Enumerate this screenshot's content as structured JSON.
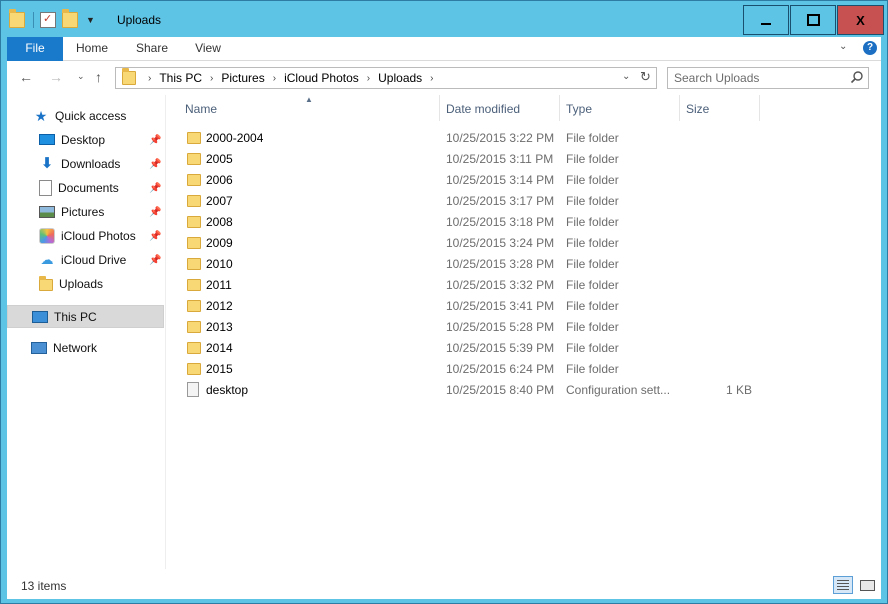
{
  "window": {
    "title": "Uploads",
    "controls": {
      "minimize": "minimize",
      "maximize": "maximize",
      "close": "X"
    }
  },
  "ribbon": {
    "tabs": [
      "File",
      "Home",
      "Share",
      "View"
    ]
  },
  "address": {
    "breadcrumbs": [
      "This PC",
      "Pictures",
      "iCloud Photos",
      "Uploads"
    ],
    "search_placeholder": "Search Uploads"
  },
  "navigation": {
    "quick_access_label": "Quick access",
    "quick_items": [
      {
        "label": "Desktop",
        "icon": "desktop-icon",
        "pinned": true
      },
      {
        "label": "Downloads",
        "icon": "downloads-icon",
        "pinned": true
      },
      {
        "label": "Documents",
        "icon": "documents-icon",
        "pinned": true
      },
      {
        "label": "Pictures",
        "icon": "pictures-icon",
        "pinned": true
      },
      {
        "label": "iCloud Photos",
        "icon": "icloud-photos-icon",
        "pinned": true
      },
      {
        "label": "iCloud Drive",
        "icon": "icloud-drive-icon",
        "pinned": true
      },
      {
        "label": "Uploads",
        "icon": "folder-icon",
        "pinned": false
      }
    ],
    "this_pc_label": "This PC",
    "network_label": "Network"
  },
  "file_list": {
    "columns": {
      "name": "Name",
      "date": "Date modified",
      "type": "Type",
      "size": "Size"
    },
    "rows": [
      {
        "name": "2000-2004",
        "date": "10/25/2015 3:22 PM",
        "type": "File folder",
        "size": "",
        "icon": "folder-icon"
      },
      {
        "name": "2005",
        "date": "10/25/2015 3:11 PM",
        "type": "File folder",
        "size": "",
        "icon": "folder-icon"
      },
      {
        "name": "2006",
        "date": "10/25/2015 3:14 PM",
        "type": "File folder",
        "size": "",
        "icon": "folder-icon"
      },
      {
        "name": "2007",
        "date": "10/25/2015 3:17 PM",
        "type": "File folder",
        "size": "",
        "icon": "folder-icon"
      },
      {
        "name": "2008",
        "date": "10/25/2015 3:18 PM",
        "type": "File folder",
        "size": "",
        "icon": "folder-icon"
      },
      {
        "name": "2009",
        "date": "10/25/2015 3:24 PM",
        "type": "File folder",
        "size": "",
        "icon": "folder-icon"
      },
      {
        "name": "2010",
        "date": "10/25/2015 3:28 PM",
        "type": "File folder",
        "size": "",
        "icon": "folder-icon"
      },
      {
        "name": "2011",
        "date": "10/25/2015 3:32 PM",
        "type": "File folder",
        "size": "",
        "icon": "folder-icon"
      },
      {
        "name": "2012",
        "date": "10/25/2015 3:41 PM",
        "type": "File folder",
        "size": "",
        "icon": "folder-icon"
      },
      {
        "name": "2013",
        "date": "10/25/2015 5:28 PM",
        "type": "File folder",
        "size": "",
        "icon": "folder-icon"
      },
      {
        "name": "2014",
        "date": "10/25/2015 5:39 PM",
        "type": "File folder",
        "size": "",
        "icon": "folder-icon"
      },
      {
        "name": "2015",
        "date": "10/25/2015 6:24 PM",
        "type": "File folder",
        "size": "",
        "icon": "folder-icon"
      },
      {
        "name": "desktop",
        "date": "10/25/2015 8:40 PM",
        "type": "Configuration sett...",
        "size": "1 KB",
        "icon": "config-file-icon"
      }
    ]
  },
  "status": {
    "item_count": "13 items"
  }
}
